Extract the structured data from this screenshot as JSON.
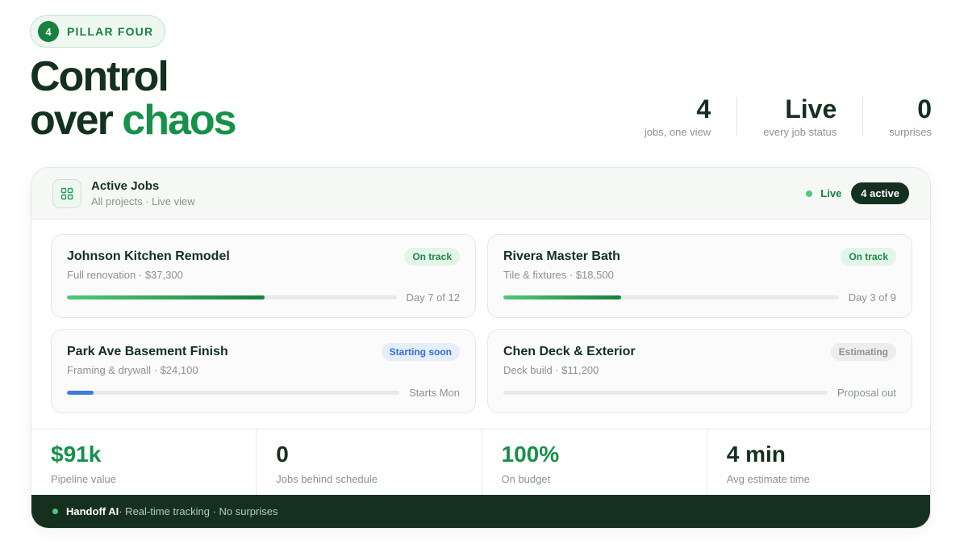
{
  "pillar": {
    "number": "4",
    "label": "PILLAR FOUR"
  },
  "hero": {
    "line1": "Control",
    "line2_prefix": "over",
    "line2_accent": "chaos"
  },
  "stats": [
    {
      "value": "4",
      "label": "jobs, one view"
    },
    {
      "value": "Live",
      "label": "every job status"
    },
    {
      "value": "0",
      "label": "surprises"
    }
  ],
  "panel": {
    "icon": "grid-icon",
    "title": "Active Jobs",
    "subtitle": "All projects · Live view",
    "live_label": "Live",
    "active_count_label": "4 active"
  },
  "jobs": [
    {
      "name": "Johnson Kitchen Remodel",
      "meta": "Full renovation · $37,300",
      "tag": "On track",
      "progress": 0.6,
      "progress_label": "Day 7 of 12",
      "color": "green"
    },
    {
      "name": "Rivera Master Bath",
      "meta": "Tile & fixtures · $18,500",
      "tag": "On track",
      "progress": 0.35,
      "progress_label": "Day 3 of 9",
      "color": "green"
    },
    {
      "name": "Park Ave Basement Finish",
      "meta": "Framing & drywall · $24,100",
      "tag": "Starting soon",
      "progress": 0.08,
      "progress_label": "Starts Mon",
      "color": "blue"
    },
    {
      "name": "Chen Deck & Exterior",
      "meta": "Deck build · $11,200",
      "tag": "Estimating",
      "progress": 0,
      "progress_label": "Proposal out",
      "color": "grey"
    }
  ],
  "metrics": [
    {
      "value": "$91k",
      "label": "Pipeline value",
      "accent": true
    },
    {
      "value": "0",
      "label": "Jobs behind schedule",
      "accent": false
    },
    {
      "value": "100%",
      "label": "On budget",
      "accent": true
    },
    {
      "value": "4 min",
      "label": "Avg estimate time",
      "accent": false
    }
  ],
  "footer": {
    "brand": "Handoff AI",
    "tagline": " · Real-time tracking · No surprises"
  },
  "colors": {
    "accent": "#16914a",
    "dark": "#14301f",
    "blue": "#3d7be0"
  }
}
